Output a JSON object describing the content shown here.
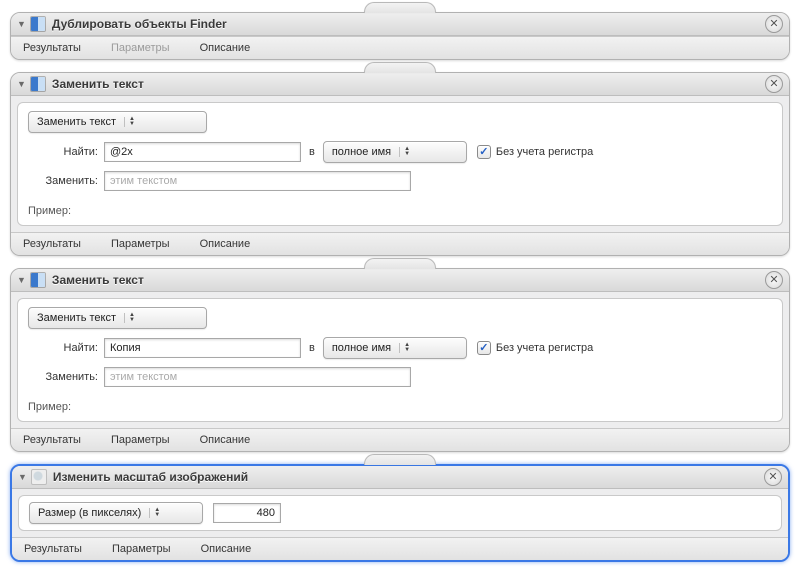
{
  "tabs": {
    "results": "Результаты",
    "options": "Параметры",
    "description": "Описание"
  },
  "common": {
    "find_label": "Найти:",
    "replace_label": "Заменить:",
    "in_label": "в",
    "scope_option": "полное имя",
    "case_insensitive": "Без учета регистра",
    "replace_placeholder": "этим текстом",
    "example_label": "Пример:",
    "mode_option": "Заменить текст"
  },
  "action1": {
    "title": "Дублировать объекты Finder"
  },
  "action2": {
    "title": "Заменить текст",
    "find_value": "@2x"
  },
  "action3": {
    "title": "Заменить текст",
    "find_value": "Копия"
  },
  "action4": {
    "title": "Изменить масштаб изображений",
    "mode_option": "Размер (в пикселях)",
    "value": "480"
  }
}
